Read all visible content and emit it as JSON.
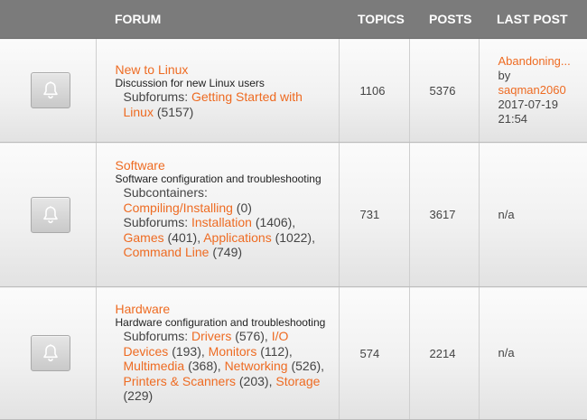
{
  "header": {
    "forum": "FORUM",
    "topics": "TOPICS",
    "posts": "POSTS",
    "last_post": "LAST POST"
  },
  "icons": {
    "forum_icon": "bell-icon"
  },
  "colors": {
    "link": "#ee6b22",
    "header_bg": "#7b7b7b"
  },
  "forums": [
    {
      "title": "New to Linux",
      "description": "Discussion for new Linux users",
      "subforums_label": "Subforums:",
      "subforums": [
        {
          "name": "Getting Started with Linux",
          "count": "(5157)"
        }
      ],
      "topics": "1106",
      "posts": "5376",
      "last_post": {
        "title": "Abandoning...",
        "by": "by",
        "user": "saqman2060",
        "date": "2017-07-19",
        "time": "21:54"
      }
    },
    {
      "title": "Software",
      "description": "Software configuration and troubleshooting",
      "subcontainers_label": "Subcontainers:",
      "subcontainers": [
        {
          "name": "Compiling/Installing",
          "count": "(0)"
        }
      ],
      "subforums_label": "Subforums:",
      "subforums": [
        {
          "name": "Installation",
          "count": "(1406),"
        },
        {
          "name": "Games",
          "count": "(401),"
        },
        {
          "name": "Applications",
          "count": "(1022),"
        },
        {
          "name": "Command Line",
          "count": "(749)"
        }
      ],
      "topics": "731",
      "posts": "3617",
      "last_post": {
        "text": "n/a"
      }
    },
    {
      "title": "Hardware",
      "description": "Hardware configuration and troubleshooting",
      "subforums_label": "Subforums:",
      "subforums": [
        {
          "name": "Drivers",
          "count": "(576),"
        },
        {
          "name": "I/O Devices",
          "count": "(193),"
        },
        {
          "name": "Monitors",
          "count": "(112),"
        },
        {
          "name": "Multimedia",
          "count": "(368),"
        },
        {
          "name": "Networking",
          "count": "(526),"
        },
        {
          "name": "Printers & Scanners",
          "count": "(203),"
        },
        {
          "name": "Storage",
          "count": "(229)"
        }
      ],
      "topics": "574",
      "posts": "2214",
      "last_post": {
        "text": "n/a"
      }
    }
  ]
}
